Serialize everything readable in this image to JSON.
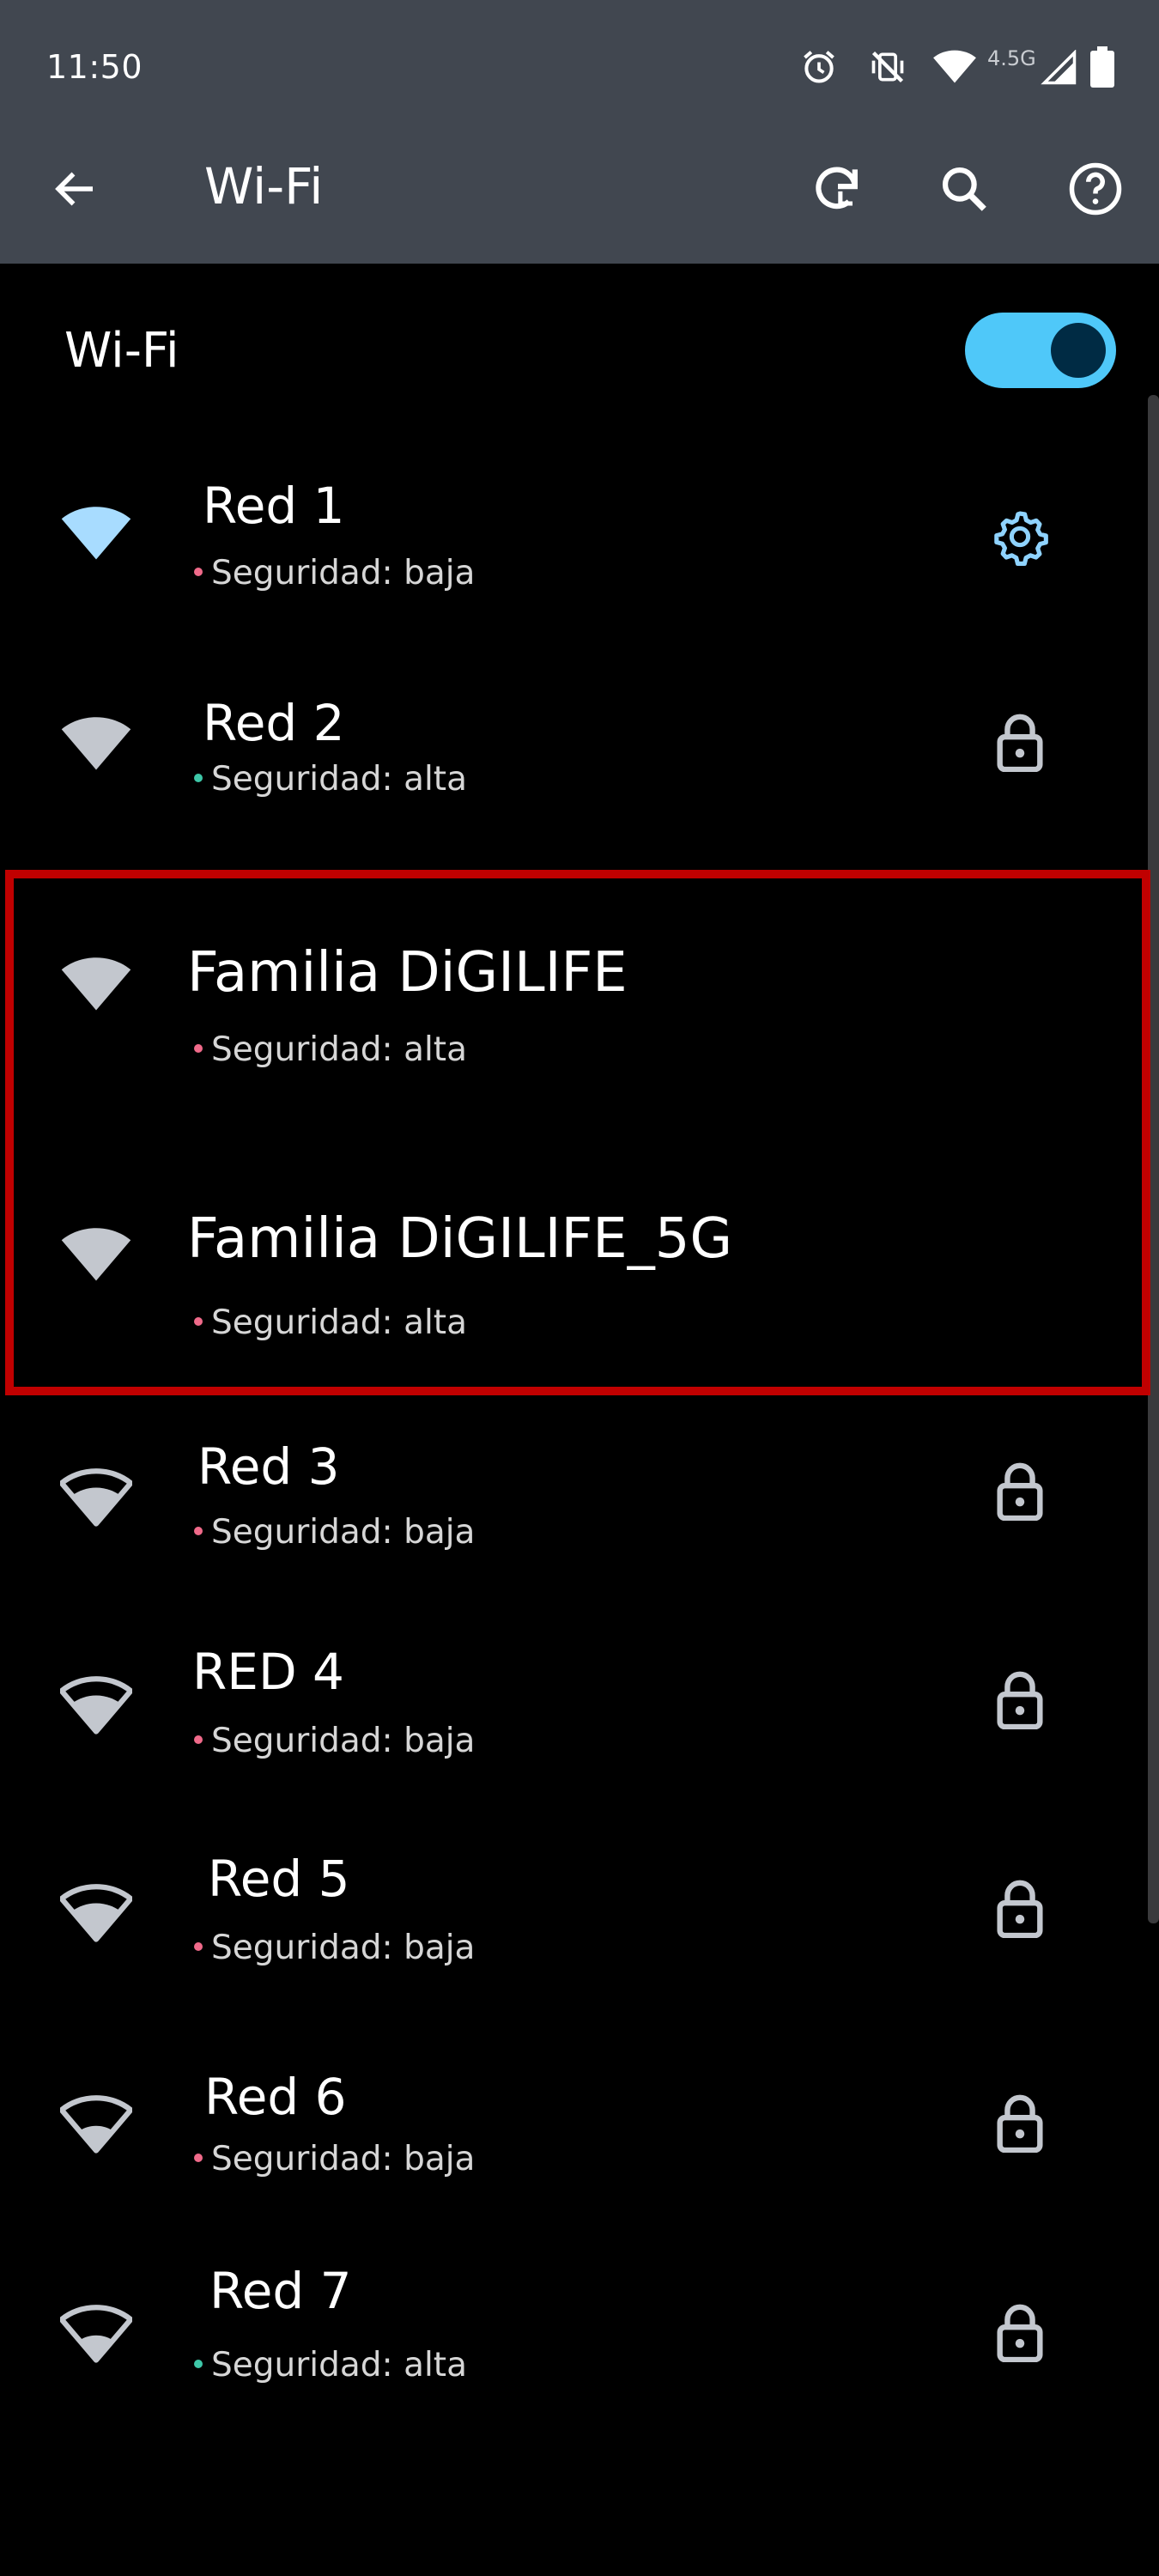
{
  "status_bar": {
    "time": "11:50",
    "network_type": "4.5G",
    "icons": [
      "alarm-icon",
      "vibrate-off-icon",
      "wifi-signal-icon",
      "cell-signal-icon",
      "battery-icon"
    ]
  },
  "app_bar": {
    "title": "Wi-Fi",
    "icons": [
      "back-arrow-icon",
      "refresh-icon",
      "search-icon",
      "help-icon"
    ]
  },
  "master": {
    "label": "Wi-Fi",
    "enabled": true
  },
  "networks": [
    {
      "name": "Red 1",
      "security_prefix": "Seguridad:",
      "security_level": "baja",
      "dot_color": "#f06a8a",
      "trailing": "gear-icon",
      "connected": true
    },
    {
      "name": "Red 2",
      "security_prefix": "Seguridad:",
      "security_level": "alta",
      "dot_color": "#3ec7a8",
      "trailing": "lock-icon"
    },
    {
      "name": "Familia DiGILIFE",
      "security_prefix": "Seguridad:",
      "security_level": "alta",
      "dot_color": "#f06a8a",
      "trailing": ""
    },
    {
      "name": "Familia DiGILIFE_5G",
      "security_prefix": "Seguridad:",
      "security_level": "alta",
      "dot_color": "#f06a8a",
      "trailing": ""
    },
    {
      "name": "Red 3",
      "security_prefix": "Seguridad:",
      "security_level": "baja",
      "dot_color": "#f06a8a",
      "trailing": "lock-icon"
    },
    {
      "name": "RED 4",
      "security_prefix": "Seguridad:",
      "security_level": "baja",
      "dot_color": "#f06a8a",
      "trailing": "lock-icon"
    },
    {
      "name": "Red 5",
      "security_prefix": "Seguridad:",
      "security_level": "baja",
      "dot_color": "#f06a8a",
      "trailing": "lock-icon"
    },
    {
      "name": "Red 6",
      "security_prefix": "Seguridad:",
      "security_level": "baja",
      "dot_color": "#f06a8a",
      "trailing": "lock-icon"
    },
    {
      "name": "Red 7",
      "security_prefix": "Seguridad:",
      "security_level": "alta",
      "dot_color": "#3ec7a8",
      "trailing": "lock-icon"
    }
  ],
  "colors": {
    "top_bar": "#414750",
    "background": "#000000",
    "accent": "#4fc8f9",
    "highlight_box": "#c00000",
    "icon_gray": "#c3c7ce"
  }
}
